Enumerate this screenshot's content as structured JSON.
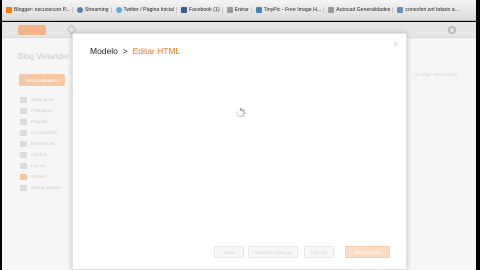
{
  "bookmarks": [
    {
      "label": "Blogger: escuoscuro P...",
      "icon": "blogger-icon"
    },
    {
      "label": "Streaming",
      "icon": "streaming-icon"
    },
    {
      "label": "Twitter / Página Inicial",
      "icon": "twitter-icon"
    },
    {
      "label": "Facebook (1)",
      "icon": "facebook-icon"
    },
    {
      "label": "Entrar",
      "icon": "page-icon"
    },
    {
      "label": "TinyPic - Free Image H...",
      "icon": "tinypic-icon"
    },
    {
      "label": "Autocad Generalidades",
      "icon": "page-icon"
    },
    {
      "label": "conecferi.wrl bdario a...",
      "icon": "doc-icon"
    }
  ],
  "backdrop": {
    "blog_title": "Blog Veilander",
    "new_post": "Nova postagem",
    "nav": [
      "Visão geral",
      "Postagens",
      "Páginas",
      "Comentários",
      "Estatísticas",
      "Ganhos",
      "Layout",
      "Modelo",
      "Configurações"
    ],
    "right_text": "Ver blog • Personalizar"
  },
  "modal": {
    "breadcrumb_base": "Modelo",
    "breadcrumb_sep": ">",
    "breadcrumb_current": "Editar HTML",
    "close": "×",
    "buttons": {
      "b1": "Salvar",
      "b2": "Visualizar mudanças",
      "b3": "Cancelar",
      "b4": "Salvar modelo"
    }
  },
  "colors": {
    "accent": "#e8791f",
    "accent_light": "#fbdcc4"
  }
}
